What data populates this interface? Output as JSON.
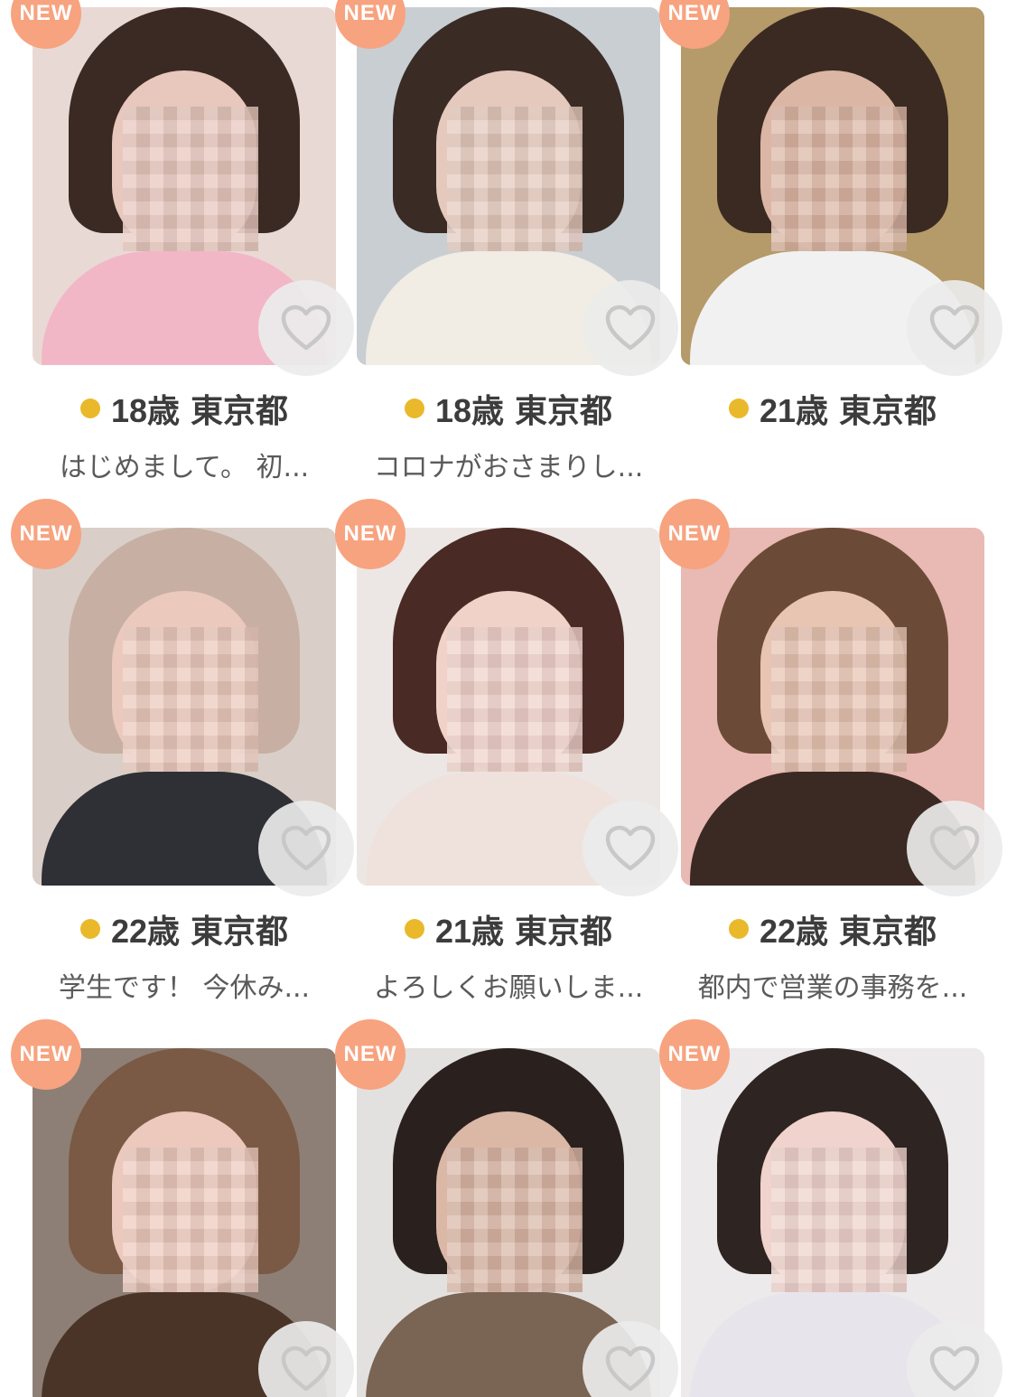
{
  "colors": {
    "new_badge": "#f7a37f",
    "online_dot": "#e9b92b",
    "like_button_bg": "#ececec",
    "text": "#3c3c3c"
  },
  "profiles": [
    {
      "badge": "NEW",
      "age": "18歳",
      "location": "東京都",
      "bio": "はじめまして。 初...",
      "photo_bg": "#e9d9d4",
      "hair": "#3b2a24",
      "face": "#e8c7bd",
      "top": "#f2b7c6"
    },
    {
      "badge": "NEW",
      "age": "18歳",
      "location": "東京都",
      "bio": "コロナがおさまりし...",
      "photo_bg": "#c9ced2",
      "hair": "#3a2b25",
      "face": "#e6c9bd",
      "top": "#f1ece4"
    },
    {
      "badge": "NEW",
      "age": "21歳",
      "location": "東京都",
      "bio": "",
      "photo_bg": "#b59a6a",
      "hair": "#3a2a22",
      "face": "#dcb6a4",
      "top": "#f1f1f1"
    },
    {
      "badge": "NEW",
      "age": "22歳",
      "location": "東京都",
      "bio": "学生です！ 今休み...",
      "photo_bg": "#d9cfc8",
      "hair": "#c7b0a3",
      "face": "#ecc9bd",
      "top": "#2f3036"
    },
    {
      "badge": "NEW",
      "age": "21歳",
      "location": "東京都",
      "bio": "よろしくお願いしま...",
      "photo_bg": "#ece7e4",
      "hair": "#4a2a24",
      "face": "#f0d2c9",
      "top": "#efe2dc"
    },
    {
      "badge": "NEW",
      "age": "22歳",
      "location": "東京都",
      "bio": "都内で営業の事務を...",
      "photo_bg": "#e9b9b3",
      "hair": "#6b4b37",
      "face": "#e8c4b2",
      "top": "#3b2a24"
    },
    {
      "badge": "NEW",
      "age": "",
      "location": "",
      "bio": "",
      "photo_bg": "#8d7f76",
      "hair": "#7a5a44",
      "face": "#edc9bd",
      "top": "#4a3428"
    },
    {
      "badge": "NEW",
      "age": "",
      "location": "",
      "bio": "",
      "photo_bg": "#e3e1df",
      "hair": "#2a211e",
      "face": "#dbb7a6",
      "top": "#7a6454"
    },
    {
      "badge": "NEW",
      "age": "",
      "location": "",
      "bio": "",
      "photo_bg": "#eceaea",
      "hair": "#2e2422",
      "face": "#f0d3cc",
      "top": "#e7e4ec"
    }
  ]
}
